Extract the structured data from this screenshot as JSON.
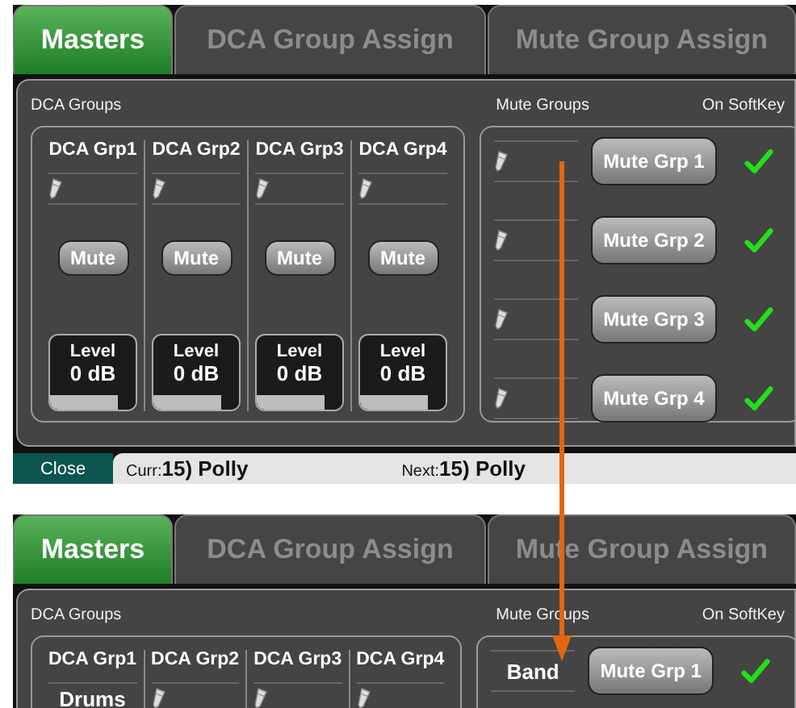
{
  "screens": [
    {
      "tabs": [
        {
          "label": "Masters",
          "selected": true
        },
        {
          "label": "DCA Group Assign",
          "selected": false
        },
        {
          "label": "Mute Group Assign",
          "selected": false
        }
      ],
      "dca": {
        "title": "DCA Groups",
        "groups": [
          {
            "name": "DCA Grp1",
            "mute": "Mute",
            "level_label": "Level",
            "value": "0 dB",
            "level": 0.8
          },
          {
            "name": "DCA Grp2",
            "mute": "Mute",
            "level_label": "Level",
            "value": "0 dB",
            "level": 0.8
          },
          {
            "name": "DCA Grp3",
            "mute": "Mute",
            "level_label": "Level",
            "value": "0 dB",
            "level": 0.8
          },
          {
            "name": "DCA Grp4",
            "mute": "Mute",
            "level_label": "Level",
            "value": "0 dB",
            "level": 0.8
          }
        ]
      },
      "mute": {
        "title": "Mute Groups",
        "softkey_title": "On SoftKey",
        "groups": [
          {
            "button": "Mute Grp 1",
            "on_softkey": true
          },
          {
            "button": "Mute Grp 2",
            "on_softkey": true
          },
          {
            "button": "Mute Grp 3",
            "on_softkey": true
          },
          {
            "button": "Mute Grp 4",
            "on_softkey": true
          }
        ]
      },
      "footer": {
        "close": "Close",
        "curr_label": "Curr:",
        "curr_value": "15) Polly",
        "next_label": "Next:",
        "next_value": "15) Polly"
      }
    },
    {
      "tabs": [
        {
          "label": "Masters",
          "selected": true
        },
        {
          "label": "DCA Group Assign",
          "selected": false
        },
        {
          "label": "Mute Group Assign",
          "selected": false
        }
      ],
      "dca": {
        "title": "DCA Groups",
        "groups": [
          {
            "name": "DCA Grp1",
            "label": "Drums"
          },
          {
            "name": "DCA Grp2"
          },
          {
            "name": "DCA Grp3"
          },
          {
            "name": "DCA Grp4"
          }
        ]
      },
      "mute": {
        "title": "Mute Groups",
        "softkey_title": "On SoftKey",
        "groups": [
          {
            "label": "Band",
            "button": "Mute Grp 1",
            "on_softkey": true
          }
        ]
      }
    }
  ]
}
